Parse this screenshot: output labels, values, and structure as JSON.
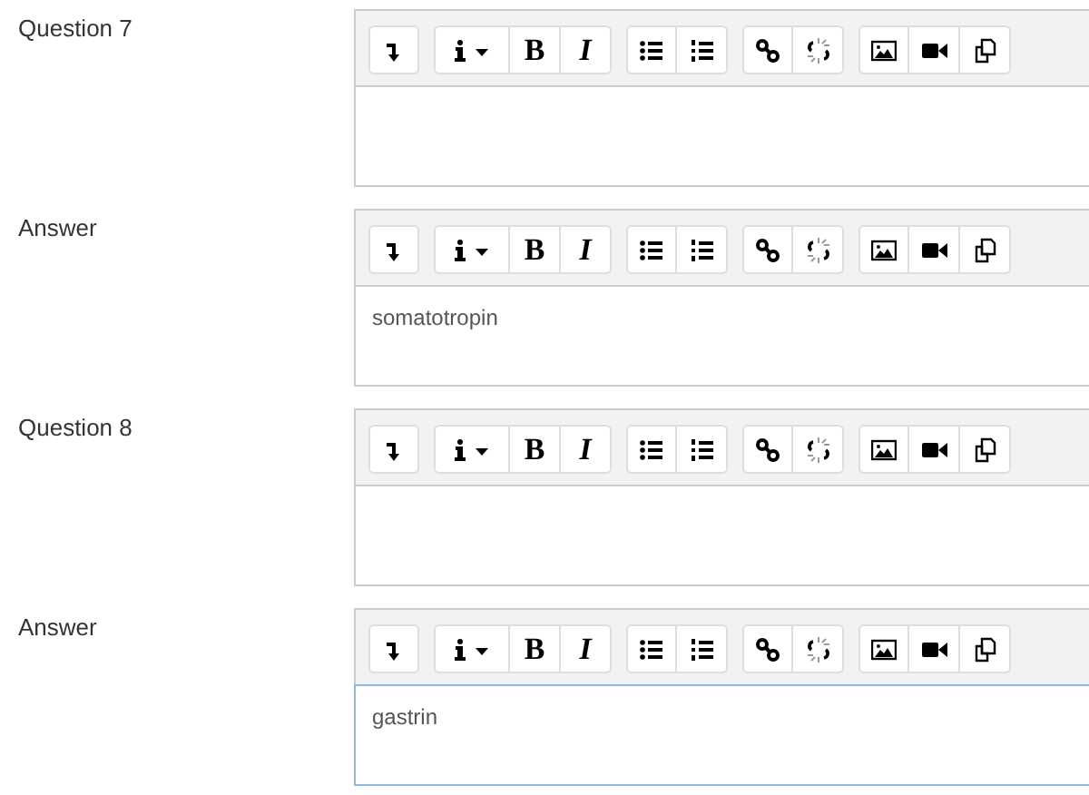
{
  "fields": [
    {
      "label": "Question 7",
      "focused": false,
      "toolbar": [
        [
          {
            "kind": "collapse"
          }
        ],
        [
          {
            "kind": "info"
          },
          {
            "kind": "bold",
            "text": "B"
          },
          {
            "kind": "italic",
            "text": "I"
          }
        ],
        [
          {
            "kind": "bullets"
          },
          {
            "kind": "numbers"
          }
        ],
        [
          {
            "kind": "link"
          },
          {
            "kind": "unlink"
          }
        ],
        [
          {
            "kind": "image"
          },
          {
            "kind": "video"
          },
          {
            "kind": "copy"
          }
        ]
      ]
    },
    {
      "label": "Answer",
      "value": "somatotropin",
      "focused": false,
      "toolbar": [
        [
          {
            "kind": "collapse"
          }
        ],
        [
          {
            "kind": "info"
          },
          {
            "kind": "bold",
            "text": "B"
          },
          {
            "kind": "italic",
            "text": "I"
          }
        ],
        [
          {
            "kind": "bullets"
          },
          {
            "kind": "numbers"
          }
        ],
        [
          {
            "kind": "link"
          },
          {
            "kind": "unlink"
          }
        ],
        [
          {
            "kind": "image"
          },
          {
            "kind": "video"
          },
          {
            "kind": "copy"
          }
        ]
      ]
    },
    {
      "label": "Question 8",
      "focused": false,
      "toolbar": [
        [
          {
            "kind": "collapse"
          }
        ],
        [
          {
            "kind": "info"
          },
          {
            "kind": "bold",
            "text": "B"
          },
          {
            "kind": "italic",
            "text": "I"
          }
        ],
        [
          {
            "kind": "bullets"
          },
          {
            "kind": "numbers"
          }
        ],
        [
          {
            "kind": "link"
          },
          {
            "kind": "unlink"
          }
        ],
        [
          {
            "kind": "image"
          },
          {
            "kind": "video"
          },
          {
            "kind": "copy"
          }
        ]
      ]
    },
    {
      "label": "Answer",
      "value": "gastrin",
      "focused": true,
      "toolbar": [
        [
          {
            "kind": "collapse"
          }
        ],
        [
          {
            "kind": "info"
          },
          {
            "kind": "bold",
            "text": "B"
          },
          {
            "kind": "italic",
            "text": "I"
          }
        ],
        [
          {
            "kind": "bullets"
          },
          {
            "kind": "numbers"
          }
        ],
        [
          {
            "kind": "link"
          },
          {
            "kind": "unlink"
          }
        ],
        [
          {
            "kind": "image"
          },
          {
            "kind": "video"
          },
          {
            "kind": "copy"
          }
        ]
      ]
    }
  ]
}
